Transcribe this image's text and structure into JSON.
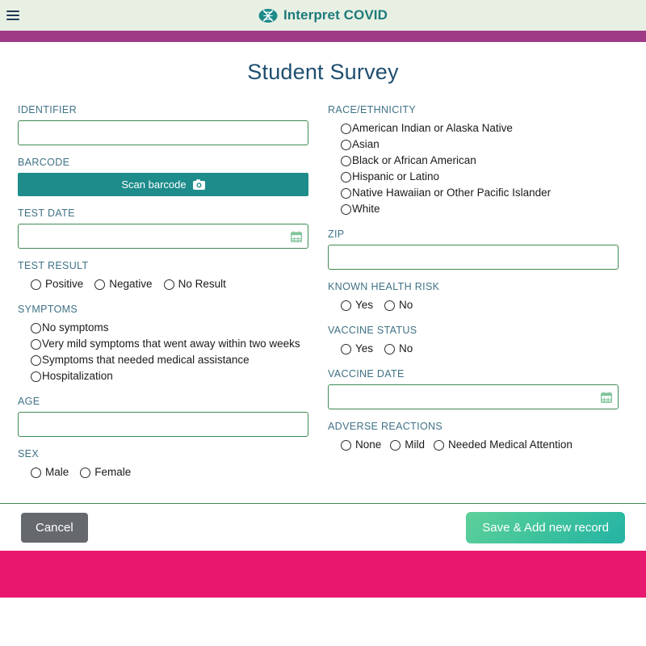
{
  "header": {
    "menu_icon": "hamburger-icon",
    "logo_icon": "dna-oval-logo-icon",
    "brand_title": "Interpret COVID",
    "bar_color": "#9f3a87",
    "background_color": "#e8f0e4",
    "brand_color": "#1d7a7a"
  },
  "page": {
    "title": "Student Survey",
    "title_color": "#1f4f70"
  },
  "left_column": {
    "identifier": {
      "label": "IDENTIFIER",
      "value": "",
      "placeholder": ""
    },
    "barcode": {
      "label": "BARCODE",
      "button_label": "Scan barcode",
      "button_icon": "camera-icon",
      "button_color": "#1f8c8c"
    },
    "test_date": {
      "label": "TEST DATE",
      "value": "",
      "placeholder": "",
      "icon": "calendar-icon"
    },
    "test_result": {
      "label": "TEST RESULT",
      "options": [
        "Positive",
        "Negative",
        "No Result"
      ],
      "selected": null
    },
    "symptoms": {
      "label": "SYMPTOMS",
      "options": [
        "No symptoms",
        "Very mild symptoms that went away within two weeks",
        "Symptoms that needed medical assistance",
        "Hospitalization"
      ],
      "selected": null
    },
    "age": {
      "label": "AGE",
      "value": "",
      "placeholder": ""
    },
    "sex": {
      "label": "SEX",
      "options": [
        "Male",
        "Female"
      ],
      "selected": null
    }
  },
  "right_column": {
    "race_ethnicity": {
      "label": "RACE/ETHNICITY",
      "options": [
        "American Indian or Alaska Native",
        "Asian",
        "Black or African American",
        "Hispanic or Latino",
        "Native Hawaiian or Other Pacific Islander",
        "White"
      ],
      "selected": null
    },
    "zip": {
      "label": "ZIP",
      "value": "",
      "placeholder": ""
    },
    "known_health_risk": {
      "label": "KNOWN HEALTH RISK",
      "options": [
        "Yes",
        "No"
      ],
      "selected": null
    },
    "vaccine_status": {
      "label": "VACCINE STATUS",
      "options": [
        "Yes",
        "No"
      ],
      "selected": null
    },
    "vaccine_date": {
      "label": "VACCINE DATE",
      "value": "",
      "placeholder": "",
      "icon": "calendar-icon"
    },
    "adverse_reactions": {
      "label": "ADVERSE REACTIONS",
      "options": [
        "None",
        "Mild",
        "Needed Medical Attention"
      ],
      "selected": null
    }
  },
  "footer": {
    "cancel_label": "Cancel",
    "save_label": "Save & Add new record",
    "cancel_color": "#65696e",
    "save_color": "#41c49c",
    "bottom_bar_color": "#e8186f"
  }
}
